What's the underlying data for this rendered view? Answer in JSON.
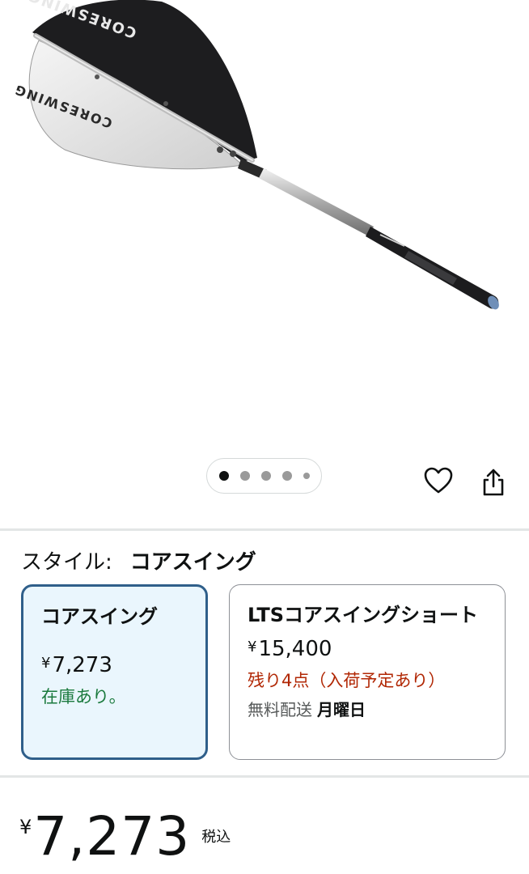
{
  "product": {
    "image_alt": "コアスイング",
    "brand_text": "CORESWING"
  },
  "gallery": {
    "dots": 5,
    "active_index": 0
  },
  "actions": {
    "heart_icon": "heart-icon",
    "share_icon": "share-icon"
  },
  "style_selector": {
    "label": "スタイル:",
    "selected_value": "コアスイング",
    "options": [
      {
        "title": "コアスイング",
        "currency": "¥",
        "price": "7,273",
        "stock": "在庫あり。",
        "selected": true
      },
      {
        "title": "LTSコアスイングショート",
        "currency": "¥",
        "price": "15,400",
        "stock": "残り4点（入荷予定あり）",
        "delivery_label": "無料配送",
        "delivery_day": "月曜日",
        "selected": false
      }
    ]
  },
  "price": {
    "currency": "¥",
    "amount": "7,273",
    "tax_note": "税込"
  },
  "colors": {
    "selected_border": "#2f5f8a",
    "selected_bg": "#eaf6fd",
    "in_stock": "#1b7a3e",
    "low_stock": "#b12704"
  }
}
